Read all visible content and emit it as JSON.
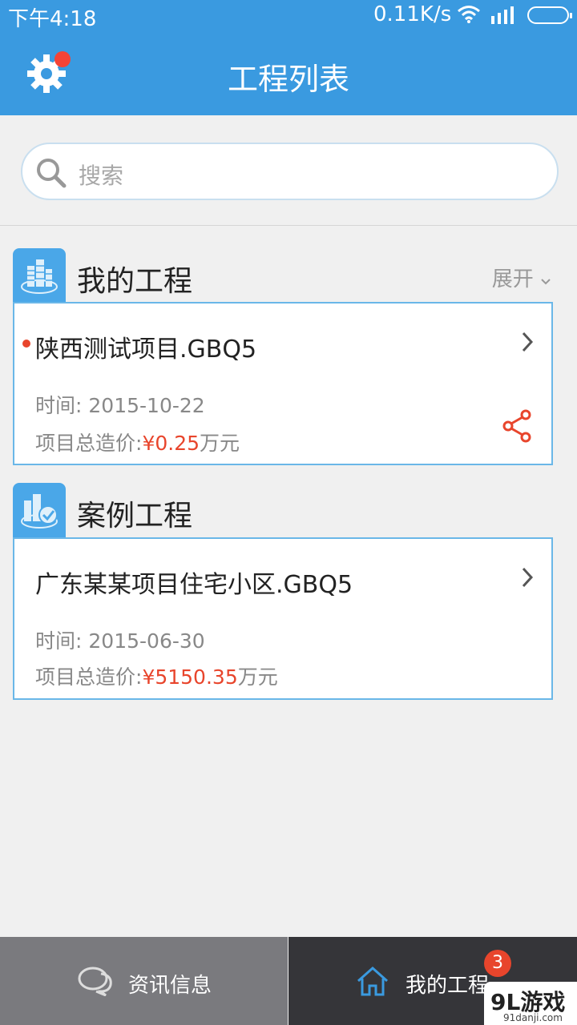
{
  "status_bar": {
    "time": "下午4:18",
    "network_speed": "0.11K/s"
  },
  "header": {
    "title": "工程列表",
    "settings_has_notification": true
  },
  "search": {
    "placeholder": "搜索"
  },
  "sections": [
    {
      "title": "我的工程",
      "expand_label": "展开",
      "projects": [
        {
          "name": "陕西测试项目.GBQ5",
          "unread": true,
          "time_label": "时间:",
          "time_value": "2015-10-22",
          "cost_label": "项目总造价:",
          "currency": "¥",
          "cost_value": "0.25",
          "unit": "万元"
        }
      ]
    },
    {
      "title": "案例工程",
      "projects": [
        {
          "name": "广东某某项目住宅小区.GBQ5",
          "unread": false,
          "time_label": "时间:",
          "time_value": "2015-06-30",
          "cost_label": "项目总造价:",
          "currency": "¥",
          "cost_value": "5150.35",
          "unit": "万元"
        }
      ]
    }
  ],
  "tab_bar": {
    "tabs": [
      {
        "label": "资讯信息",
        "icon": "chat-icon",
        "active": false
      },
      {
        "label": "我的工程",
        "icon": "home-icon",
        "active": true,
        "badge": "3"
      }
    ]
  },
  "watermark": {
    "text": "9L游戏",
    "url": "91danji.com"
  },
  "colors": {
    "primary": "#3a9ae0",
    "accent_red": "#e8452c",
    "card_border": "#6ab7e8"
  }
}
